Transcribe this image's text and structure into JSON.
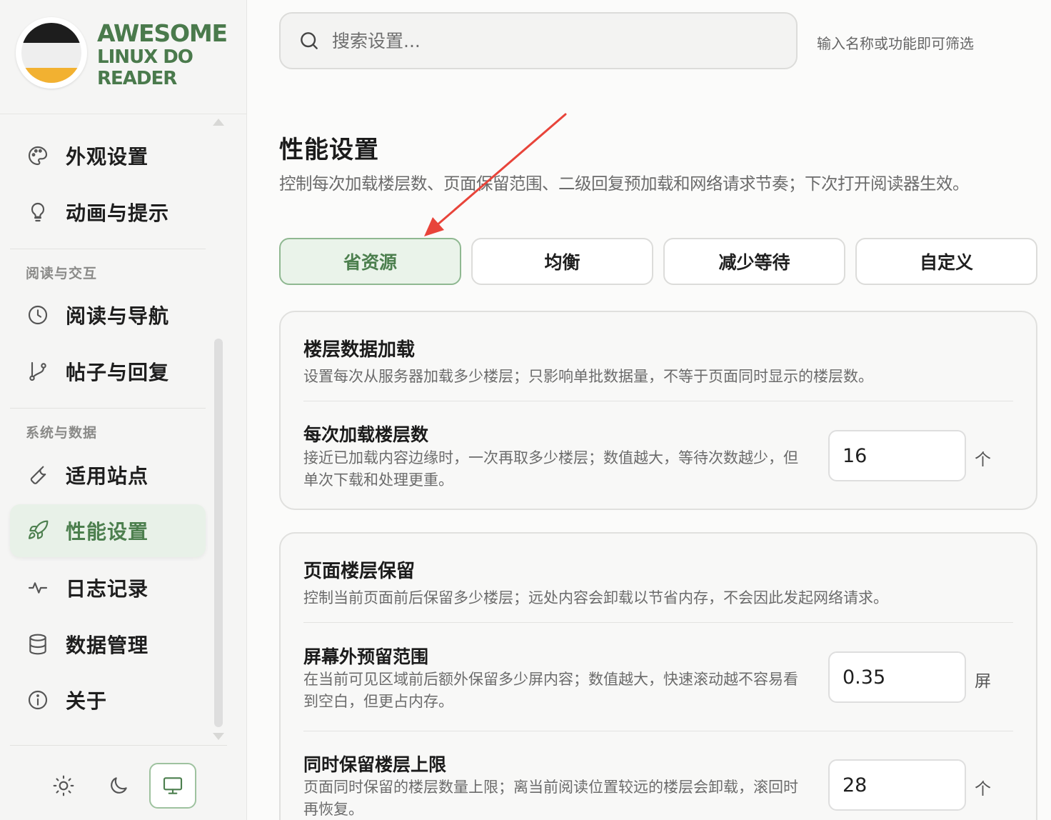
{
  "brand": {
    "line1": "AWESOME",
    "line2": "LINUX DO",
    "line3": "READER"
  },
  "nav": {
    "items": [
      {
        "id": "appearance",
        "label": "外观设置",
        "icon": "palette-icon"
      },
      {
        "id": "animation",
        "label": "动画与提示",
        "icon": "lightbulb-icon"
      },
      {
        "id": "reading",
        "label": "阅读与导航",
        "icon": "clock-icon"
      },
      {
        "id": "posts",
        "label": "帖子与回复",
        "icon": "git-branch-icon"
      },
      {
        "id": "sites",
        "label": "适用站点",
        "icon": "wrench-icon"
      },
      {
        "id": "performance",
        "label": "性能设置",
        "icon": "rocket-icon",
        "active": true
      },
      {
        "id": "logs",
        "label": "日志记录",
        "icon": "activity-icon"
      },
      {
        "id": "data",
        "label": "数据管理",
        "icon": "database-icon"
      },
      {
        "id": "about",
        "label": "关于",
        "icon": "info-icon"
      }
    ],
    "groups": {
      "reading": "阅读与交互",
      "system": "系统与数据"
    }
  },
  "theme": {
    "options": [
      "light",
      "dark",
      "system"
    ],
    "selected": "system"
  },
  "search": {
    "placeholder": "搜索设置...",
    "value": "",
    "hint": "输入名称或功能即可筛选"
  },
  "section": {
    "title": "性能设置",
    "description": "控制每次加载楼层数、页面保留范围、二级回复预加载和网络请求节奏；下次打开阅读器生效。"
  },
  "presets": {
    "items": [
      "省资源",
      "均衡",
      "减少等待",
      "自定义"
    ],
    "selected": "省资源"
  },
  "cards": [
    {
      "title": "楼层数据加载",
      "description": "设置每次从服务器加载多少楼层；只影响单批数据量，不等于页面同时显示的楼层数。",
      "rows": [
        {
          "label": "每次加载楼层数",
          "help": "接近已加载内容边缘时，一次再取多少楼层；数值越大，等待次数越少，但单次下载和处理更重。",
          "value": "16",
          "unit": "个"
        }
      ]
    },
    {
      "title": "页面楼层保留",
      "description": "控制当前页面前后保留多少楼层；远处内容会卸载以节省内存，不会因此发起网络请求。",
      "rows": [
        {
          "label": "屏幕外预留范围",
          "help": "在当前可见区域前后额外保留多少屏内容；数值越大，快速滚动越不容易看到空白，但更占内存。",
          "value": "0.35",
          "unit": "屏"
        },
        {
          "label": "同时保留楼层上限",
          "help": "页面同时保留的楼层数量上限；离当前阅读位置较远的楼层会卸载，滚回时再恢复。",
          "value": "28",
          "unit": "个"
        }
      ]
    }
  ],
  "colors": {
    "accent": "#4c7f4e",
    "accent_bg": "#e8f1e8",
    "annotation_arrow": "#e8443a"
  }
}
